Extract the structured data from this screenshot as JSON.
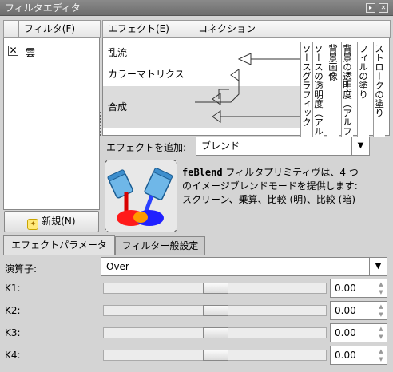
{
  "window": {
    "title": "フィルタエディタ"
  },
  "filters": {
    "header": "フィルタ(F)",
    "items": [
      {
        "label": "雲",
        "checked": true
      }
    ],
    "new_button": "新規(N)"
  },
  "effects": {
    "header_effect": "エフェクト(E)",
    "header_connection": "コネクション",
    "items": [
      "乱流",
      "カラーマトリクス",
      "合成"
    ],
    "inputs": [
      "ソースグラフィック",
      "ソースの透明度（アルファ）",
      "背景画像",
      "背景の透明度（アルファ）",
      "フィルの塗り",
      "ストロークの塗り"
    ],
    "add_label": "エフェクトを追加:",
    "add_value": "ブレンド",
    "description_name": "feBlend",
    "description_text": " フィルタプリミティヴは、4 つのイメージブレンドモードを提供します: スクリーン、乗算、比較 (明)、比較 (暗)"
  },
  "tabs": [
    "エフェクトパラメータ",
    "フィルター般設定"
  ],
  "params": {
    "operator_label": "演算子:",
    "operator_value": "Over",
    "k": [
      {
        "label": "K1:",
        "value": "0.00",
        "level": 0.5
      },
      {
        "label": "K2:",
        "value": "0.00",
        "level": 0.5
      },
      {
        "label": "K3:",
        "value": "0.00",
        "level": 0.5
      },
      {
        "label": "K4:",
        "value": "0.00",
        "level": 0.5
      }
    ]
  }
}
